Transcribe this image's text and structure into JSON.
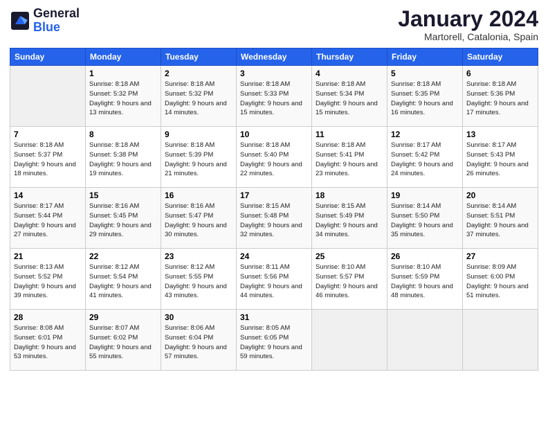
{
  "logo": {
    "text_general": "General",
    "text_blue": "Blue"
  },
  "header": {
    "month": "January 2024",
    "location": "Martorell, Catalonia, Spain"
  },
  "weekdays": [
    "Sunday",
    "Monday",
    "Tuesday",
    "Wednesday",
    "Thursday",
    "Friday",
    "Saturday"
  ],
  "weeks": [
    [
      {
        "day": "",
        "sunrise": "",
        "sunset": "",
        "daylight": "",
        "empty": true
      },
      {
        "day": "1",
        "sunrise": "Sunrise: 8:18 AM",
        "sunset": "Sunset: 5:32 PM",
        "daylight": "Daylight: 9 hours and 13 minutes."
      },
      {
        "day": "2",
        "sunrise": "Sunrise: 8:18 AM",
        "sunset": "Sunset: 5:32 PM",
        "daylight": "Daylight: 9 hours and 14 minutes."
      },
      {
        "day": "3",
        "sunrise": "Sunrise: 8:18 AM",
        "sunset": "Sunset: 5:33 PM",
        "daylight": "Daylight: 9 hours and 15 minutes."
      },
      {
        "day": "4",
        "sunrise": "Sunrise: 8:18 AM",
        "sunset": "Sunset: 5:34 PM",
        "daylight": "Daylight: 9 hours and 15 minutes."
      },
      {
        "day": "5",
        "sunrise": "Sunrise: 8:18 AM",
        "sunset": "Sunset: 5:35 PM",
        "daylight": "Daylight: 9 hours and 16 minutes."
      },
      {
        "day": "6",
        "sunrise": "Sunrise: 8:18 AM",
        "sunset": "Sunset: 5:36 PM",
        "daylight": "Daylight: 9 hours and 17 minutes."
      }
    ],
    [
      {
        "day": "7",
        "sunrise": "Sunrise: 8:18 AM",
        "sunset": "Sunset: 5:37 PM",
        "daylight": "Daylight: 9 hours and 18 minutes."
      },
      {
        "day": "8",
        "sunrise": "Sunrise: 8:18 AM",
        "sunset": "Sunset: 5:38 PM",
        "daylight": "Daylight: 9 hours and 19 minutes."
      },
      {
        "day": "9",
        "sunrise": "Sunrise: 8:18 AM",
        "sunset": "Sunset: 5:39 PM",
        "daylight": "Daylight: 9 hours and 21 minutes."
      },
      {
        "day": "10",
        "sunrise": "Sunrise: 8:18 AM",
        "sunset": "Sunset: 5:40 PM",
        "daylight": "Daylight: 9 hours and 22 minutes."
      },
      {
        "day": "11",
        "sunrise": "Sunrise: 8:18 AM",
        "sunset": "Sunset: 5:41 PM",
        "daylight": "Daylight: 9 hours and 23 minutes."
      },
      {
        "day": "12",
        "sunrise": "Sunrise: 8:17 AM",
        "sunset": "Sunset: 5:42 PM",
        "daylight": "Daylight: 9 hours and 24 minutes."
      },
      {
        "day": "13",
        "sunrise": "Sunrise: 8:17 AM",
        "sunset": "Sunset: 5:43 PM",
        "daylight": "Daylight: 9 hours and 26 minutes."
      }
    ],
    [
      {
        "day": "14",
        "sunrise": "Sunrise: 8:17 AM",
        "sunset": "Sunset: 5:44 PM",
        "daylight": "Daylight: 9 hours and 27 minutes."
      },
      {
        "day": "15",
        "sunrise": "Sunrise: 8:16 AM",
        "sunset": "Sunset: 5:45 PM",
        "daylight": "Daylight: 9 hours and 29 minutes."
      },
      {
        "day": "16",
        "sunrise": "Sunrise: 8:16 AM",
        "sunset": "Sunset: 5:47 PM",
        "daylight": "Daylight: 9 hours and 30 minutes."
      },
      {
        "day": "17",
        "sunrise": "Sunrise: 8:15 AM",
        "sunset": "Sunset: 5:48 PM",
        "daylight": "Daylight: 9 hours and 32 minutes."
      },
      {
        "day": "18",
        "sunrise": "Sunrise: 8:15 AM",
        "sunset": "Sunset: 5:49 PM",
        "daylight": "Daylight: 9 hours and 34 minutes."
      },
      {
        "day": "19",
        "sunrise": "Sunrise: 8:14 AM",
        "sunset": "Sunset: 5:50 PM",
        "daylight": "Daylight: 9 hours and 35 minutes."
      },
      {
        "day": "20",
        "sunrise": "Sunrise: 8:14 AM",
        "sunset": "Sunset: 5:51 PM",
        "daylight": "Daylight: 9 hours and 37 minutes."
      }
    ],
    [
      {
        "day": "21",
        "sunrise": "Sunrise: 8:13 AM",
        "sunset": "Sunset: 5:52 PM",
        "daylight": "Daylight: 9 hours and 39 minutes."
      },
      {
        "day": "22",
        "sunrise": "Sunrise: 8:12 AM",
        "sunset": "Sunset: 5:54 PM",
        "daylight": "Daylight: 9 hours and 41 minutes."
      },
      {
        "day": "23",
        "sunrise": "Sunrise: 8:12 AM",
        "sunset": "Sunset: 5:55 PM",
        "daylight": "Daylight: 9 hours and 43 minutes."
      },
      {
        "day": "24",
        "sunrise": "Sunrise: 8:11 AM",
        "sunset": "Sunset: 5:56 PM",
        "daylight": "Daylight: 9 hours and 44 minutes."
      },
      {
        "day": "25",
        "sunrise": "Sunrise: 8:10 AM",
        "sunset": "Sunset: 5:57 PM",
        "daylight": "Daylight: 9 hours and 46 minutes."
      },
      {
        "day": "26",
        "sunrise": "Sunrise: 8:10 AM",
        "sunset": "Sunset: 5:59 PM",
        "daylight": "Daylight: 9 hours and 48 minutes."
      },
      {
        "day": "27",
        "sunrise": "Sunrise: 8:09 AM",
        "sunset": "Sunset: 6:00 PM",
        "daylight": "Daylight: 9 hours and 51 minutes."
      }
    ],
    [
      {
        "day": "28",
        "sunrise": "Sunrise: 8:08 AM",
        "sunset": "Sunset: 6:01 PM",
        "daylight": "Daylight: 9 hours and 53 minutes."
      },
      {
        "day": "29",
        "sunrise": "Sunrise: 8:07 AM",
        "sunset": "Sunset: 6:02 PM",
        "daylight": "Daylight: 9 hours and 55 minutes."
      },
      {
        "day": "30",
        "sunrise": "Sunrise: 8:06 AM",
        "sunset": "Sunset: 6:04 PM",
        "daylight": "Daylight: 9 hours and 57 minutes."
      },
      {
        "day": "31",
        "sunrise": "Sunrise: 8:05 AM",
        "sunset": "Sunset: 6:05 PM",
        "daylight": "Daylight: 9 hours and 59 minutes."
      },
      {
        "day": "",
        "sunrise": "",
        "sunset": "",
        "daylight": "",
        "empty": true
      },
      {
        "day": "",
        "sunrise": "",
        "sunset": "",
        "daylight": "",
        "empty": true
      },
      {
        "day": "",
        "sunrise": "",
        "sunset": "",
        "daylight": "",
        "empty": true
      }
    ]
  ]
}
